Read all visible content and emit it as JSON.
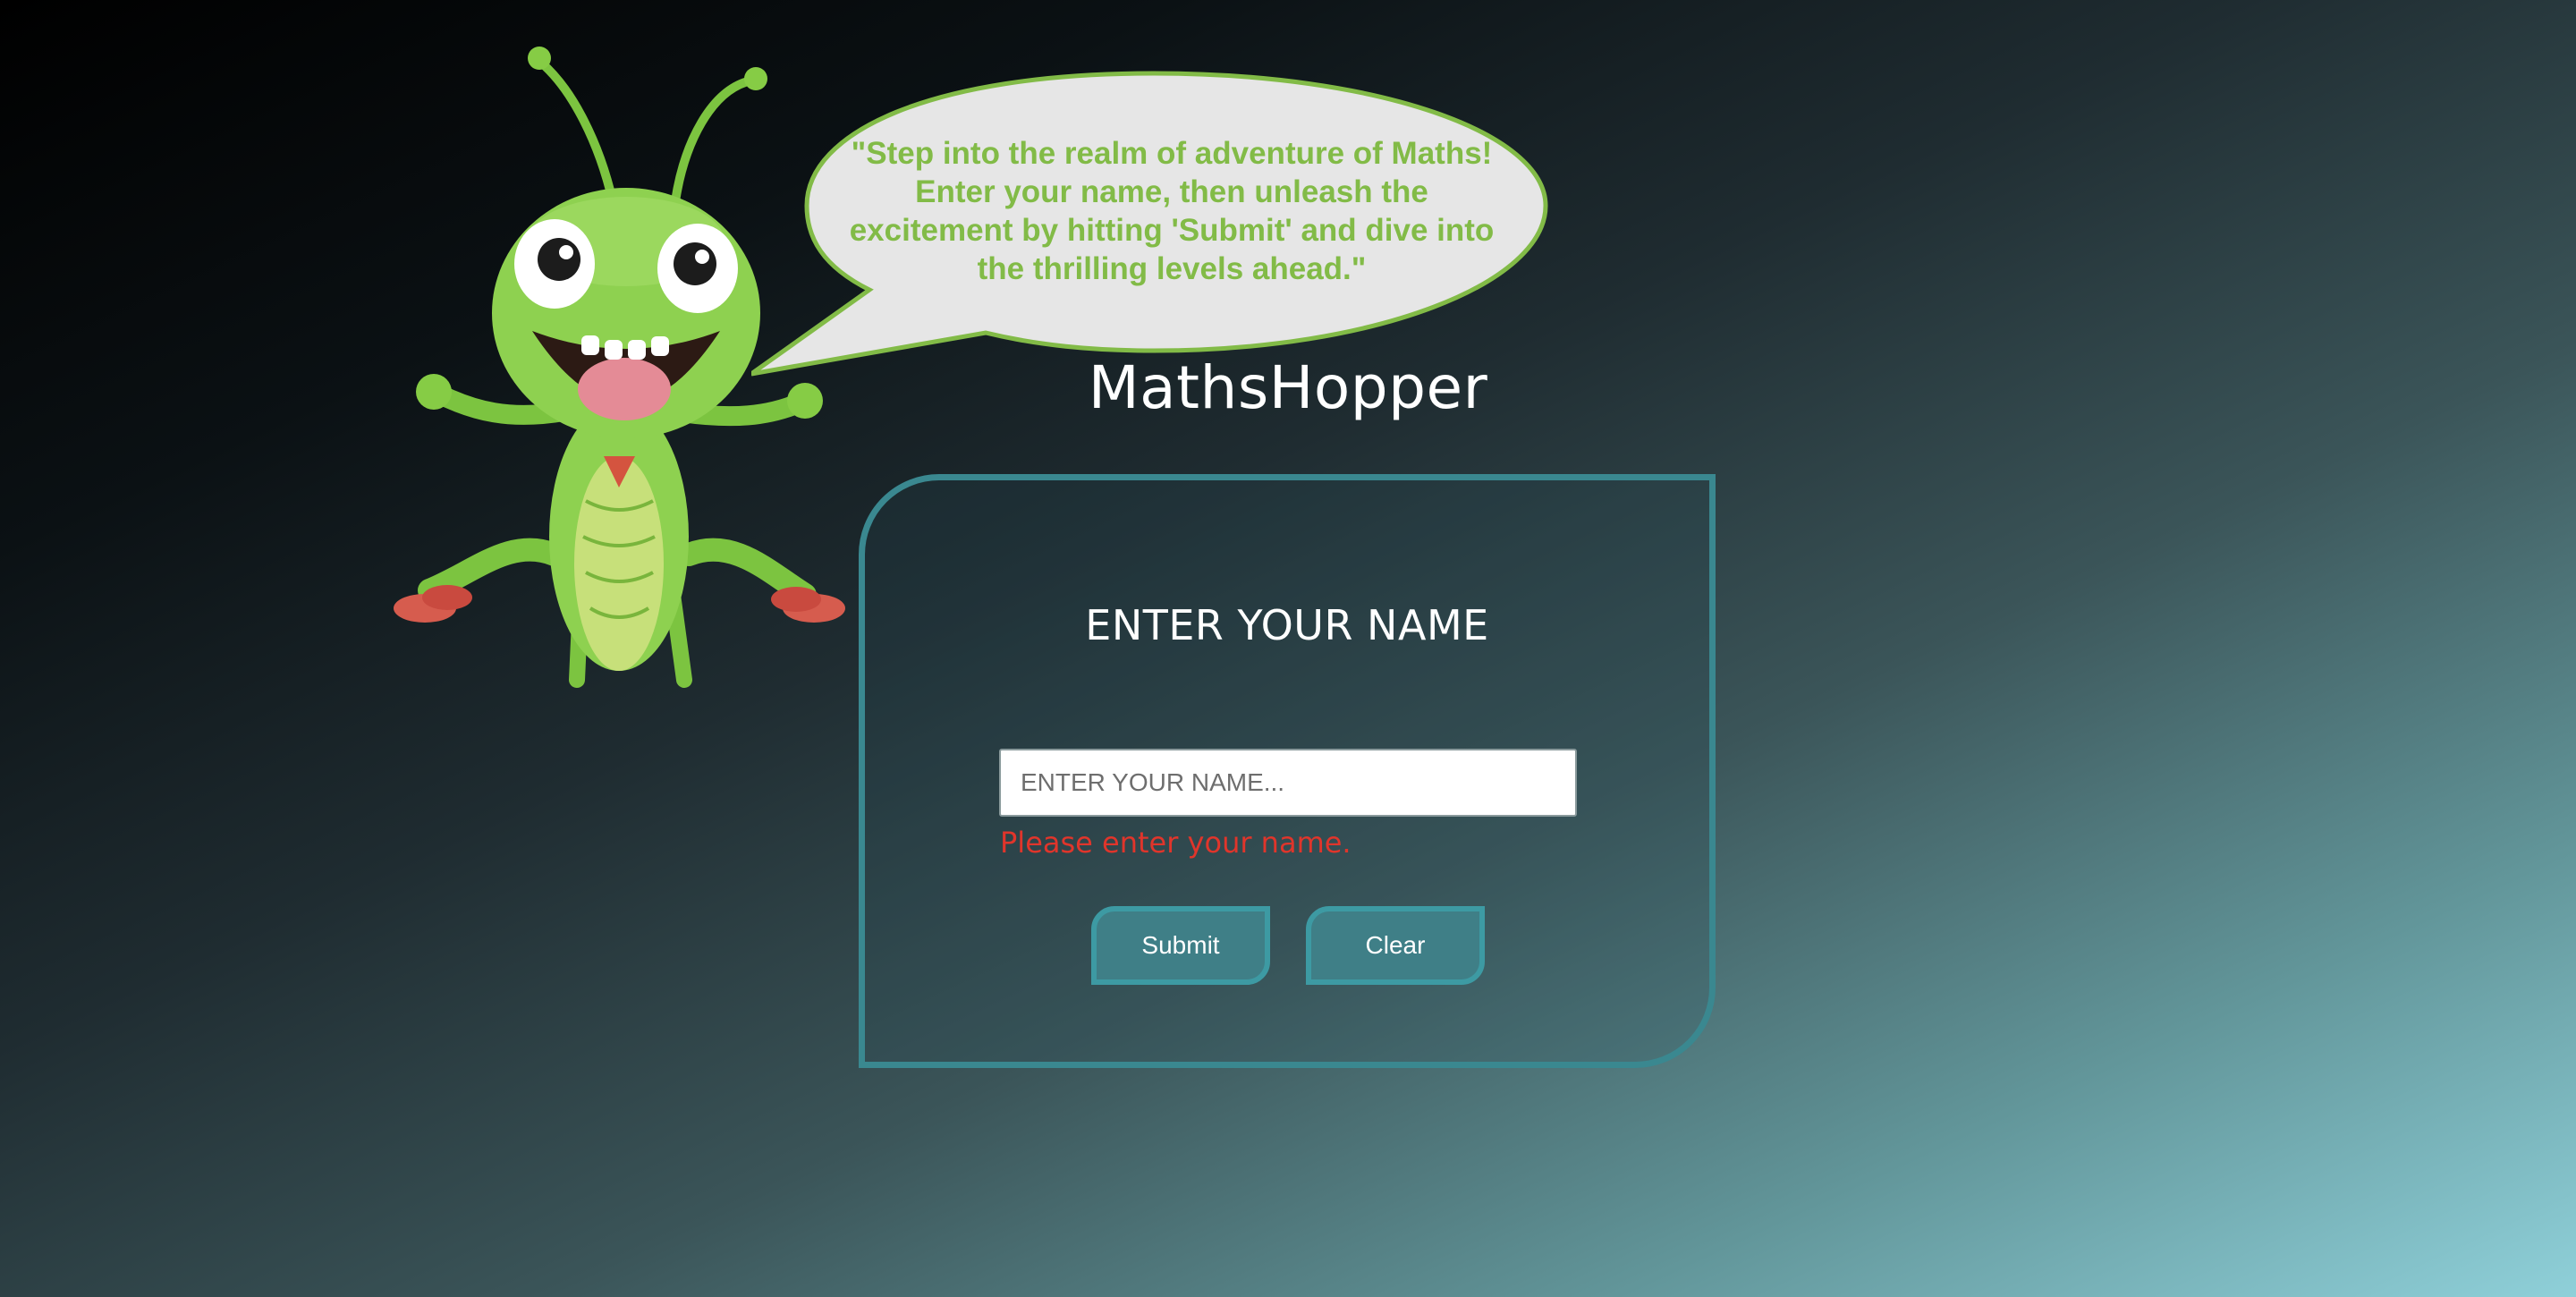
{
  "bubble": {
    "text": "\"Step into the realm of adventure of Maths! Enter your name, then unleash the excitement by hitting 'Submit' and dive into the thrilling levels ahead.\""
  },
  "app": {
    "title": "MathsHopper"
  },
  "form": {
    "heading": "ENTER YOUR NAME",
    "name_placeholder": "ENTER YOUR NAME...",
    "name_value": "",
    "error": "Please enter your name.",
    "submit_label": "Submit",
    "clear_label": "Clear"
  },
  "colors": {
    "bubble_text": "#82bb47",
    "error": "#e0352b",
    "accent": "#3a8890",
    "button_fill": "#3f7f87"
  },
  "icons": {
    "mascot": "grasshopper-mascot-icon"
  }
}
